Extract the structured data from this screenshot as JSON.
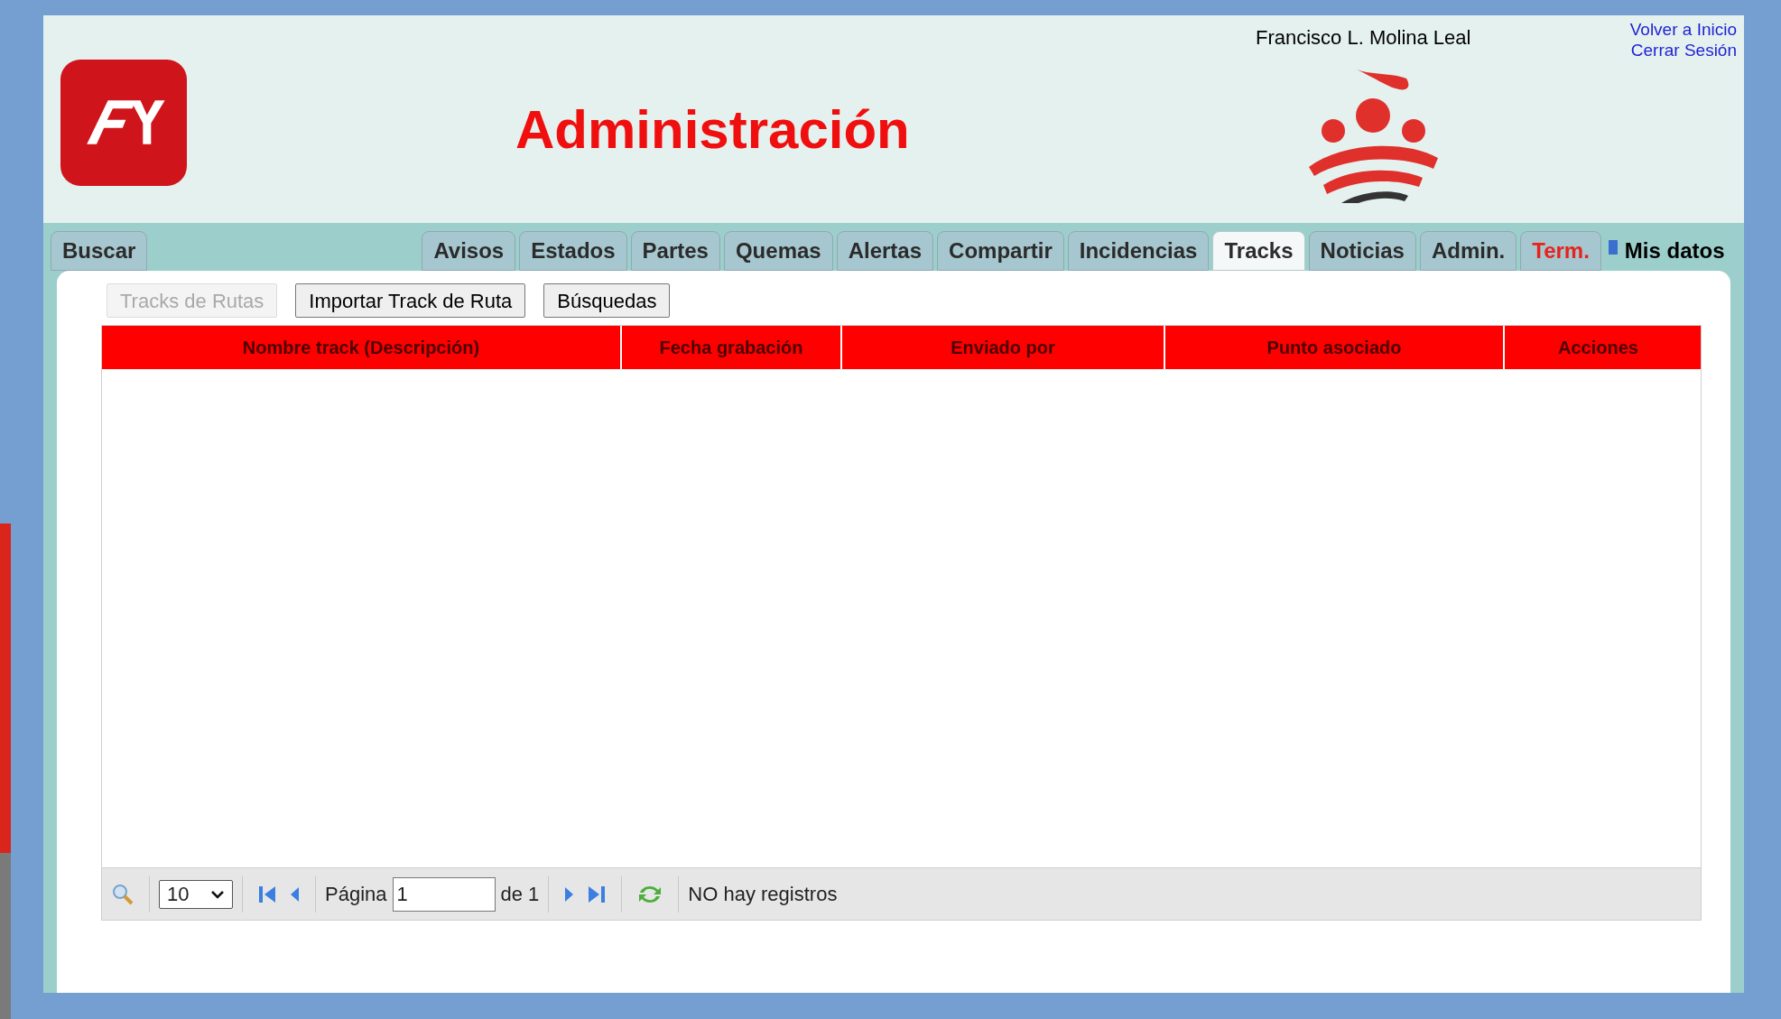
{
  "header": {
    "title": "Administración",
    "user_name": "Francisco L. Molina Leal",
    "links": [
      "Volver a Inicio",
      "Cerrar Sesión"
    ]
  },
  "tabs": [
    {
      "label": "Buscar",
      "kind": "normal",
      "selected": false
    },
    {
      "label": "Avisos",
      "kind": "normal",
      "selected": false
    },
    {
      "label": "Estados",
      "kind": "normal",
      "selected": false
    },
    {
      "label": "Partes",
      "kind": "normal",
      "selected": false
    },
    {
      "label": "Quemas",
      "kind": "normal",
      "selected": false
    },
    {
      "label": "Alertas",
      "kind": "normal",
      "selected": false
    },
    {
      "label": "Compartir",
      "kind": "normal",
      "selected": false
    },
    {
      "label": "Incidencias",
      "kind": "normal",
      "selected": false
    },
    {
      "label": "Tracks",
      "kind": "normal",
      "selected": true
    },
    {
      "label": "Noticias",
      "kind": "normal",
      "selected": false
    },
    {
      "label": "Admin.",
      "kind": "normal",
      "selected": false
    },
    {
      "label": "Term.",
      "kind": "warning",
      "selected": false
    },
    {
      "label": "Mis datos",
      "kind": "plain",
      "selected": false
    }
  ],
  "buttons": [
    {
      "label": "Tracks de Rutas",
      "disabled": true
    },
    {
      "label": "Importar Track de Ruta",
      "disabled": false
    },
    {
      "label": "Búsquedas",
      "disabled": false
    }
  ],
  "table": {
    "columns": [
      "Nombre track (Descripción)",
      "Fecha grabación",
      "Enviado por",
      "Punto asociado",
      "Acciones"
    ]
  },
  "pager": {
    "page_size": "10",
    "page_label": "Página",
    "page": "1",
    "page_total": "de 1",
    "status": "NO hay registros"
  }
}
